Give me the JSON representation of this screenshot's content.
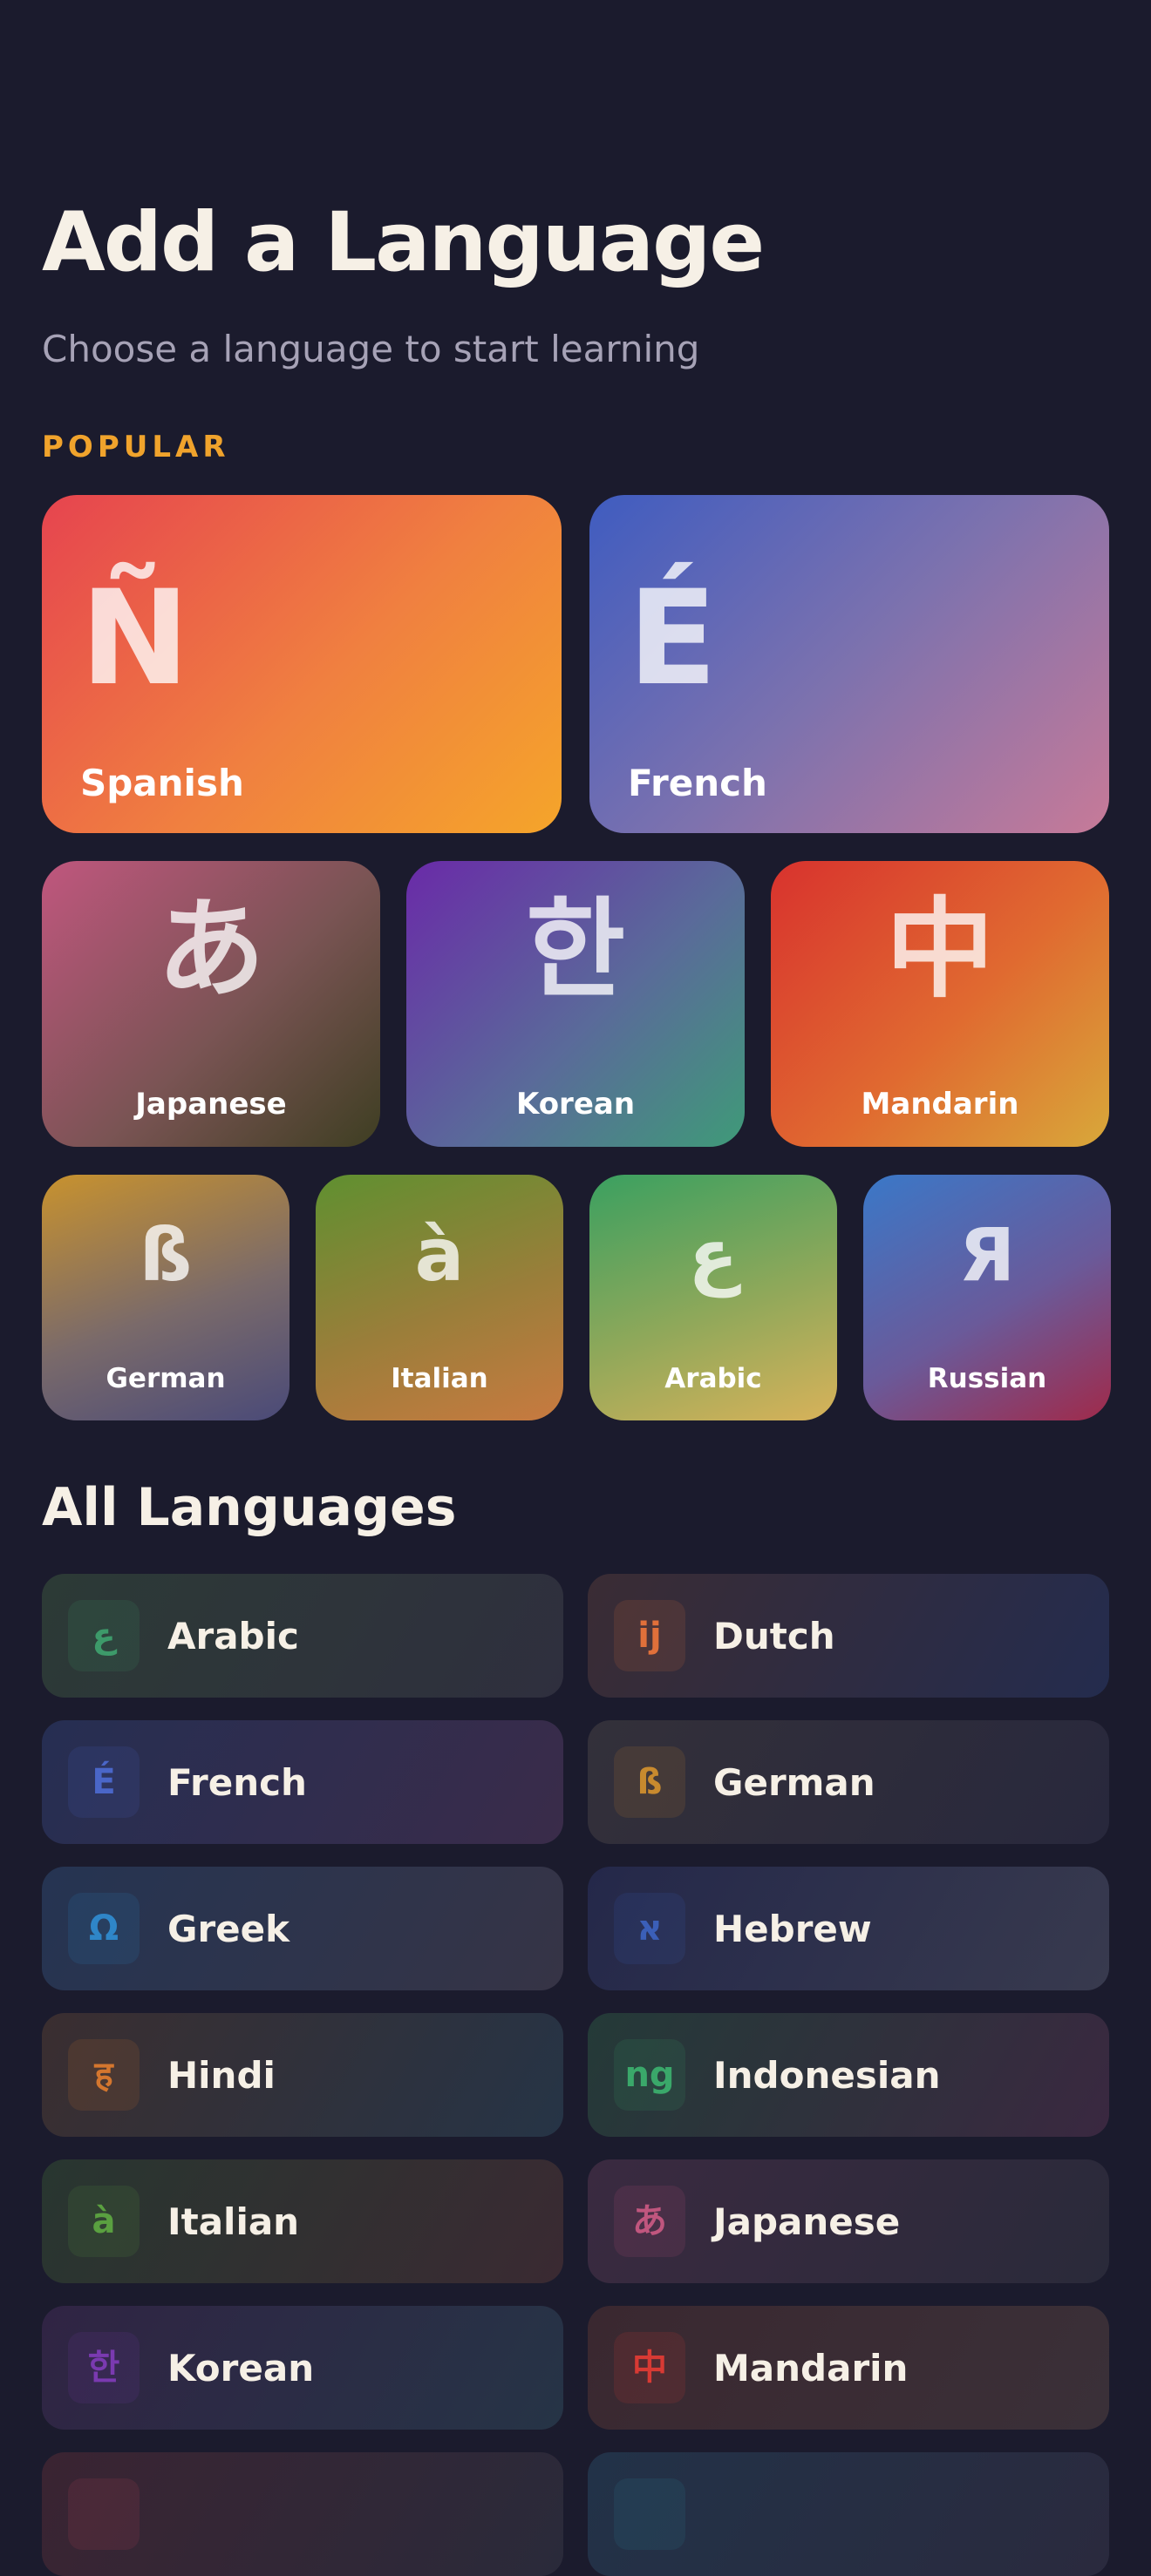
{
  "header": {
    "title": "Add a Language",
    "subtitle": "Choose a language to start learning"
  },
  "popular": {
    "label": "POPULAR",
    "featured": [
      {
        "name": "Spanish",
        "glyph": "Ñ"
      },
      {
        "name": "French",
        "glyph": "É"
      }
    ],
    "medium": [
      {
        "name": "Japanese",
        "glyph": "あ"
      },
      {
        "name": "Korean",
        "glyph": "한"
      },
      {
        "name": "Mandarin",
        "glyph": "中"
      }
    ],
    "small": [
      {
        "name": "German",
        "glyph": "ß"
      },
      {
        "name": "Italian",
        "glyph": "à"
      },
      {
        "name": "Arabic",
        "glyph": "ع"
      },
      {
        "name": "Russian",
        "glyph": "Я"
      }
    ]
  },
  "all_languages": {
    "title": "All Languages",
    "items": [
      {
        "name": "Arabic",
        "glyph": "ع",
        "color": "#3d9a6a"
      },
      {
        "name": "Dutch",
        "glyph": "ij",
        "color": "#e0703a"
      },
      {
        "name": "French",
        "glyph": "É",
        "color": "#4a66c8"
      },
      {
        "name": "German",
        "glyph": "ß",
        "color": "#c88a2e"
      },
      {
        "name": "Greek",
        "glyph": "Ω",
        "color": "#2f86c8"
      },
      {
        "name": "Hebrew",
        "glyph": "א",
        "color": "#3b5fb8"
      },
      {
        "name": "Hindi",
        "glyph": "ह",
        "color": "#d4762e"
      },
      {
        "name": "Indonesian",
        "glyph": "ng",
        "color": "#3aa86a"
      },
      {
        "name": "Italian",
        "glyph": "à",
        "color": "#5aa040"
      },
      {
        "name": "Japanese",
        "glyph": "あ",
        "color": "#c0567e"
      },
      {
        "name": "Korean",
        "glyph": "한",
        "color": "#7a3ab0"
      },
      {
        "name": "Mandarin",
        "glyph": "中",
        "color": "#d83a34"
      },
      {
        "name": "",
        "glyph": "",
        "color": "#c0405a"
      },
      {
        "name": "",
        "glyph": "",
        "color": "#2a8aa0"
      }
    ]
  },
  "colors": {
    "background": "#1b1b2d",
    "accent": "#f0a32c",
    "text_primary": "#f6f0e6",
    "text_secondary": "#a6a2b6"
  }
}
